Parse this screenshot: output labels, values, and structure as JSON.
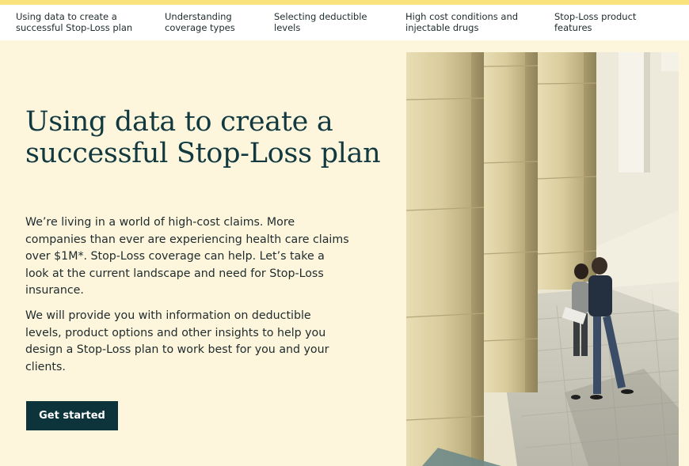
{
  "nav": {
    "items": [
      {
        "label": "Using data to create a successful Stop-Loss plan"
      },
      {
        "label": "Understanding coverage types"
      },
      {
        "label": "Selecting deductible levels"
      },
      {
        "label": "High cost conditions and injectable drugs"
      },
      {
        "label": "Stop-Loss product features"
      }
    ]
  },
  "hero": {
    "title": "Using data to create a successful Stop-Loss plan",
    "paragraph_1": "We’re living in a world of high-cost claims. More companies than ever are experiencing health care claims over $1M*. Stop-Loss coverage can help. Let’s take a look at the current landscape and need for Stop-Loss insurance.",
    "paragraph_2": "We will provide you with information on deductible levels, product options and other insights to help you design a Stop-Loss plan to work best for you and your clients.",
    "cta_label": "Get started"
  },
  "colors": {
    "accent_stripe": "#fae27c",
    "background": "#fdf6dd",
    "title": "#11393f",
    "button": "#0e343b"
  }
}
